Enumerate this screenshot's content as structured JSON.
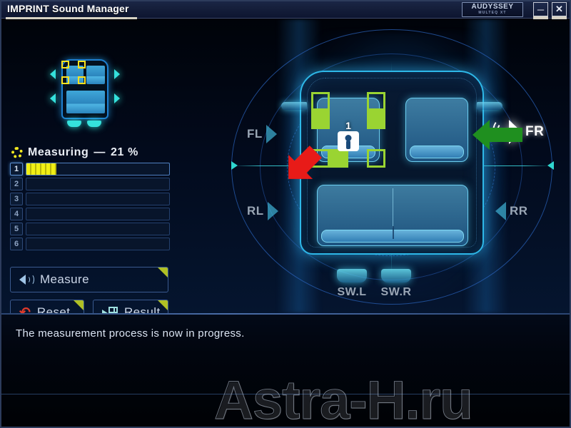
{
  "window": {
    "title": "IMPRINT Sound Manager",
    "brand_main": "AUDYSSEY",
    "brand_sub": "MULTEQ XT",
    "minimize_label": "─",
    "close_label": "✕"
  },
  "panel": {
    "status_label": "Measuring",
    "status_separator": "—",
    "progress_percent": "21 %",
    "progress_value": 21,
    "rows": [
      {
        "num": "1",
        "fill": 21,
        "active": true
      },
      {
        "num": "2",
        "fill": 0,
        "active": false
      },
      {
        "num": "3",
        "fill": 0,
        "active": false
      },
      {
        "num": "4",
        "fill": 0,
        "active": false
      },
      {
        "num": "5",
        "fill": 0,
        "active": false
      },
      {
        "num": "6",
        "fill": 0,
        "active": false
      }
    ],
    "buttons": {
      "measure": "Measure",
      "reset": "Reset",
      "result": "Result"
    },
    "reset_glyph": "↶"
  },
  "diagram": {
    "speakers": {
      "front_left": "FL",
      "front_right": "FR",
      "rear_left": "RL",
      "rear_right": "RR"
    },
    "subwoofers": {
      "left": "SW.L",
      "right": "SW.R"
    },
    "active_speaker": "FR",
    "mic_position_number": "1"
  },
  "statusbar": {
    "message": "The measurement process is now in progress."
  },
  "watermark": {
    "text": "Astra-H.ru"
  },
  "colors": {
    "accent_cyan": "#2eb8e8",
    "select_green": "#9ad432",
    "progress_yellow": "#f2ef14",
    "arrow_red": "#e81b18",
    "arrow_green": "#1f8f1f",
    "thumb_select_yellow": "#ffe21f"
  }
}
